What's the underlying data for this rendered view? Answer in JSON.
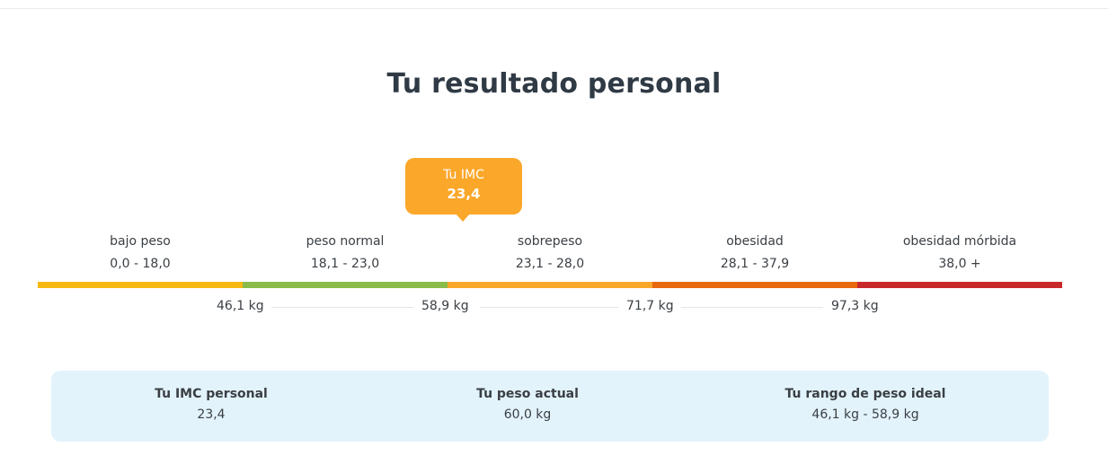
{
  "page": {
    "title": "Tu resultado personal"
  },
  "tooltip": {
    "label": "Tu IMC",
    "value": "23,4",
    "color": "#fba72a"
  },
  "categories": [
    {
      "name": "bajo peso",
      "range": "0,0 - 18,0",
      "color": "#f7b812"
    },
    {
      "name": "peso normal",
      "range": "18,1 - 23,0",
      "color": "#8bbb48"
    },
    {
      "name": "sobrepeso",
      "range": "23,1 - 28,0",
      "color": "#fba72a"
    },
    {
      "name": "obesidad",
      "range": "28,1 - 37,9",
      "color": "#e8690d"
    },
    {
      "name": "obesidad mórbida",
      "range": "38,0 +",
      "color": "#c9282a"
    }
  ],
  "weights": [
    "46,1 kg",
    "58,9 kg",
    "71,7 kg",
    "97,3 kg"
  ],
  "summary": {
    "bmi_label": "Tu IMC personal",
    "bmi_value": "23,4",
    "weight_label": "Tu peso actual",
    "weight_value": "60,0 kg",
    "ideal_label": "Tu rango de peso ideal",
    "ideal_value": "46,1 kg - 58,9 kg"
  }
}
